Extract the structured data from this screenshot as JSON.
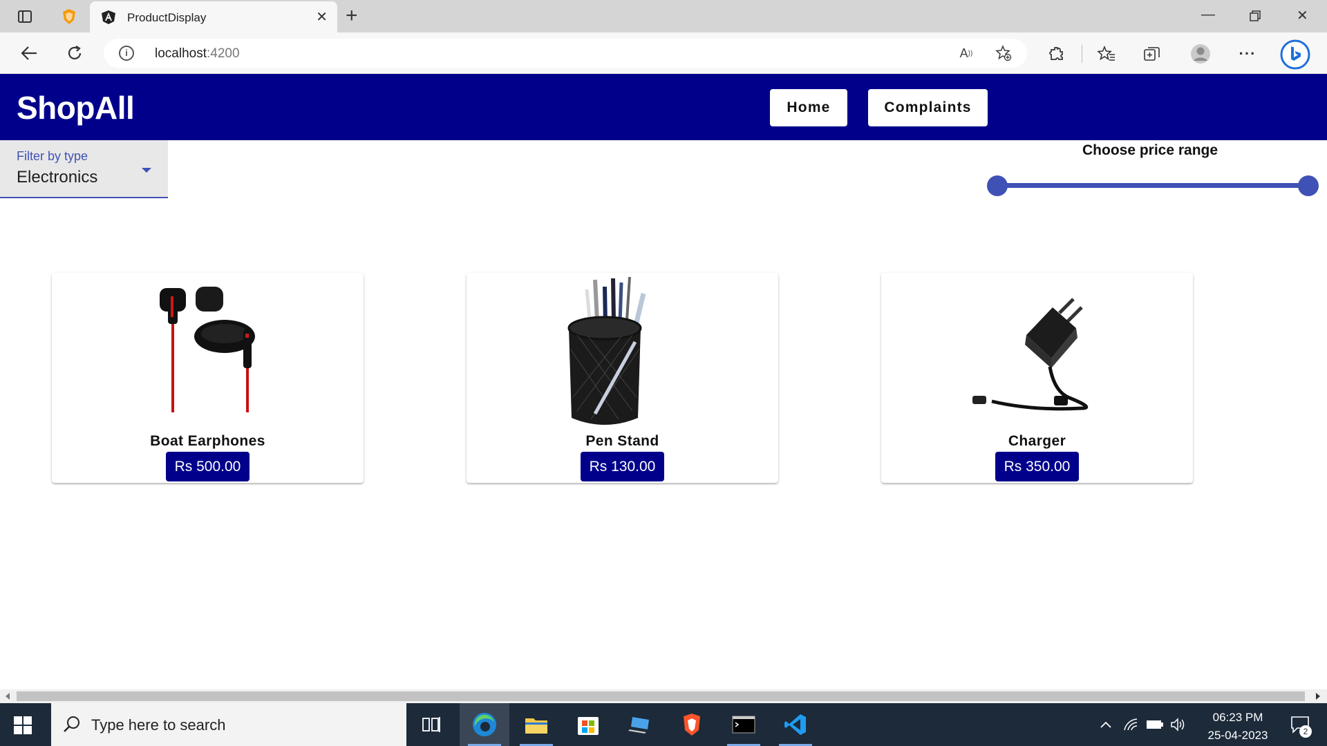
{
  "browser": {
    "tab_title": "ProductDisplay",
    "url_host": "localhost",
    "url_port": ":4200"
  },
  "app": {
    "title": "ShopAll",
    "nav": {
      "home_label": "Home",
      "complaints_label": "Complaints"
    }
  },
  "filter": {
    "label": "Filter by type",
    "value": "Electronics"
  },
  "price_range": {
    "label": "Choose price range",
    "min_position": 0,
    "max_position": 1
  },
  "products": [
    {
      "name": "Boat Earphones",
      "price": "Rs 500.00",
      "icon": "earphones-image"
    },
    {
      "name": "Pen Stand",
      "price": "Rs 130.00",
      "icon": "pen-stand-image"
    },
    {
      "name": "Charger",
      "price": "Rs 350.00",
      "icon": "charger-image"
    }
  ],
  "taskbar": {
    "search_placeholder": "Type here to search",
    "time": "06:23 PM",
    "date": "25-04-2023",
    "notification_count": "2"
  },
  "colors": {
    "header": "#00008b",
    "accent": "#3f51b5",
    "price_badge": "#00008b"
  }
}
